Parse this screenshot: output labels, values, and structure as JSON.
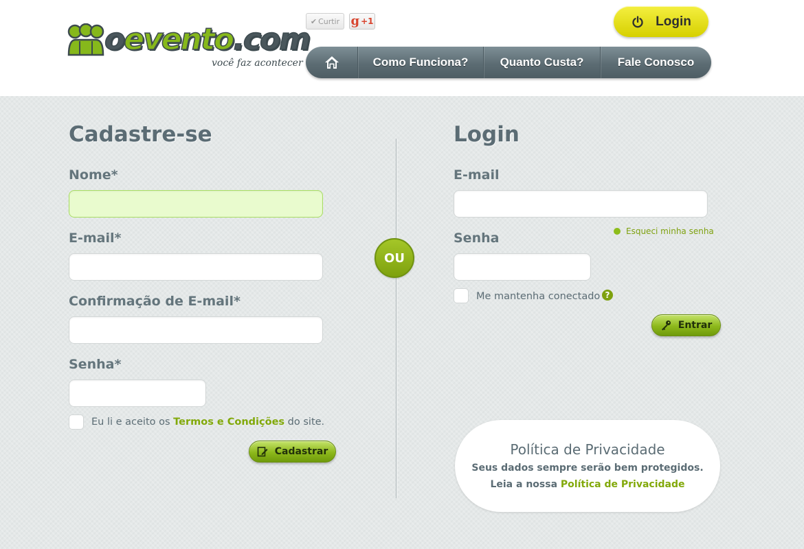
{
  "header": {
    "logo": {
      "text_light": "o",
      "text_main": "evento",
      "text_tld": ".com",
      "tagline": "você faz acontecer"
    },
    "social": {
      "curtir_label": "Curtir",
      "gplus_g": "g",
      "gplus_label": "+1"
    },
    "login_button": {
      "label": "Login",
      "icon": "power-icon",
      "color": "#e8e31e"
    },
    "nav": {
      "home_icon": "home-icon",
      "items": [
        {
          "label": "Como Funciona?"
        },
        {
          "label": "Quanto Custa?"
        },
        {
          "label": "Fale Conosco"
        }
      ]
    }
  },
  "register": {
    "title": "Cadastre-se",
    "fields": {
      "nome": {
        "label": "Nome*",
        "value": ""
      },
      "email": {
        "label": "E-mail*",
        "value": ""
      },
      "email_confirm": {
        "label": "Confirmação de E-mail*",
        "value": ""
      },
      "senha": {
        "label": "Senha*",
        "value": ""
      }
    },
    "terms": {
      "prefix": "Eu li e aceito os ",
      "link": "Termos e Condições",
      "suffix": " do site.",
      "checked": false
    },
    "submit_label": "Cadastrar",
    "submit_icon": "edit-icon"
  },
  "divider_label": "OU",
  "login": {
    "title": "Login",
    "fields": {
      "email": {
        "label": "E-mail",
        "value": ""
      },
      "senha": {
        "label": "Senha",
        "value": ""
      }
    },
    "forgot_label": "Esqueci minha senha",
    "remember": {
      "label": "Me mantenha conectado",
      "checked": false,
      "help_symbol": "?"
    },
    "submit_label": "Entrar",
    "submit_icon": "key-icon"
  },
  "privacy": {
    "title": "Política de Privacidade",
    "line1": "Seus dados sempre serão bem protegidos.",
    "line2_prefix": "Leia a nossa ",
    "line2_link": "Política de Privacidade"
  },
  "colors": {
    "accent_green": "#8db81b",
    "nav_gray": "#5c6c73",
    "heading": "#5b6c74",
    "background": "#e4e8e8"
  }
}
